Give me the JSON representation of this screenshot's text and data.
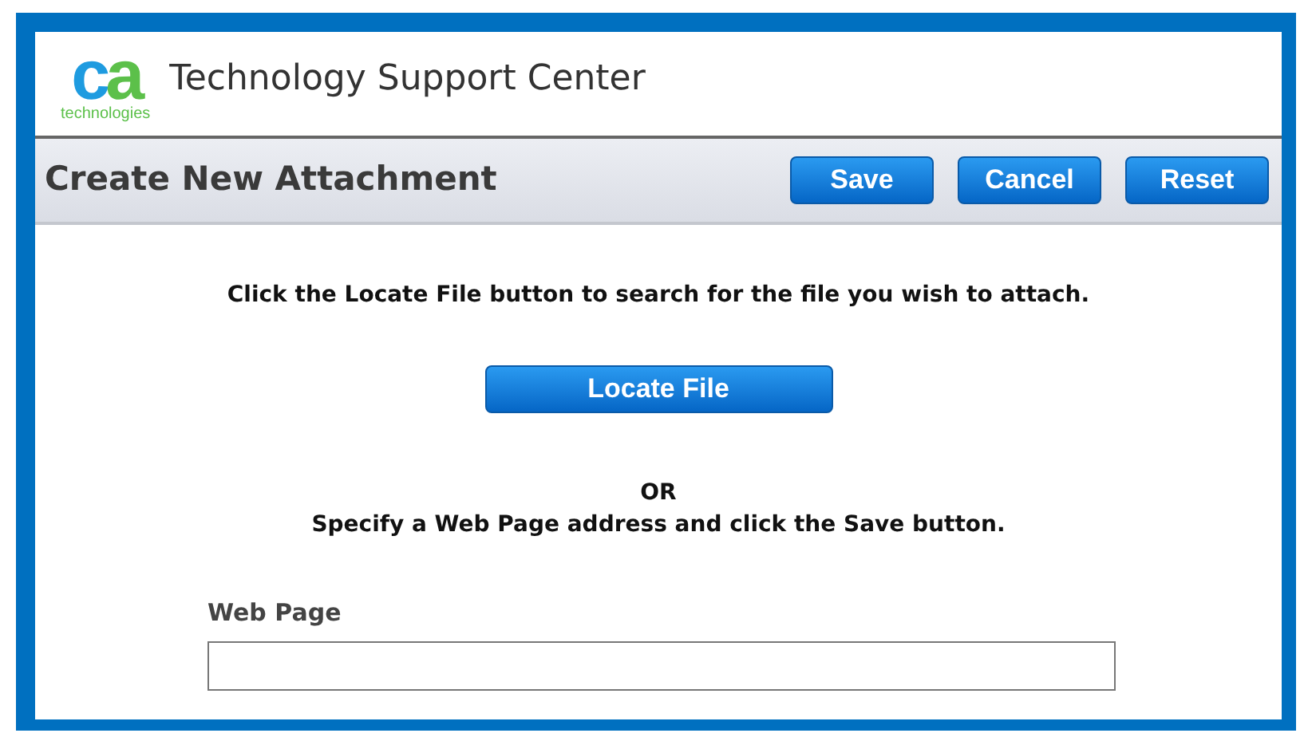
{
  "header": {
    "logo_mark": "ca",
    "logo_tagline": "technologies",
    "title": "Technology Support Center"
  },
  "toolbar": {
    "title": "Create New Attachment",
    "buttons": [
      "Save",
      "Cancel",
      "Reset"
    ]
  },
  "instructions": "Click the Locate File button to search for the file you wish to attach.",
  "locate_button": "Locate File",
  "or_text": "OR",
  "alt_instructions": "Specify a Web Page address and click the Save button.",
  "web_page_field": {
    "label": "Web Page"
  }
}
